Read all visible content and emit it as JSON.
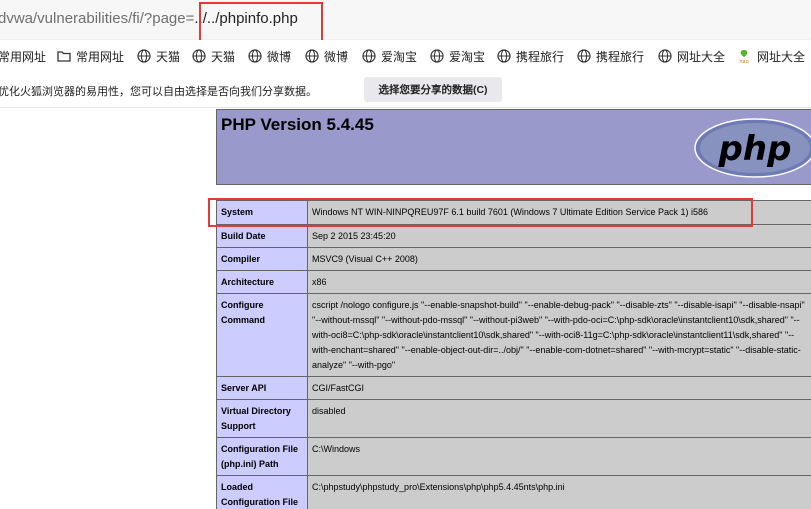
{
  "url": {
    "prefix": "dvwa/vulnerabilities/fi/?page=",
    "highlighted": "../../phpinfo.php"
  },
  "bookmarks": [
    {
      "label": "常用网址",
      "icon": "plain-bookmark"
    },
    {
      "label": "常用网址",
      "icon": "folder-icon"
    },
    {
      "label": "天猫",
      "icon": "globe-icon"
    },
    {
      "label": "天猫",
      "icon": "globe-icon"
    },
    {
      "label": "微博",
      "icon": "globe-icon"
    },
    {
      "label": "微博",
      "icon": "globe-icon"
    },
    {
      "label": "爱淘宝",
      "icon": "globe-icon"
    },
    {
      "label": "爱淘宝",
      "icon": "globe-icon"
    },
    {
      "label": "携程旅行",
      "icon": "globe-icon"
    },
    {
      "label": "携程旅行",
      "icon": "globe-icon"
    },
    {
      "label": "网址大全",
      "icon": "globe-icon"
    },
    {
      "label": "网址大全",
      "icon": "hao123-icon"
    }
  ],
  "notice": {
    "text": "优化火狐浏览器的易用性，您可以自由选择是否向我们分享数据。",
    "button": "选择您要分享的数据(C)"
  },
  "php": {
    "title": "PHP Version 5.4.45",
    "logo_text": "php",
    "rows": [
      {
        "key": "System",
        "value": "Windows NT WIN-NINPQREU97F 6.1 build 7601 (Windows 7 Ultimate Edition Service Pack 1) i586"
      },
      {
        "key": "Build Date",
        "value": "Sep 2 2015 23:45:20"
      },
      {
        "key": "Compiler",
        "value": "MSVC9 (Visual C++ 2008)"
      },
      {
        "key": "Architecture",
        "value": "x86"
      },
      {
        "key": "Configure Command",
        "value": "cscript /nologo configure.js \"--enable-snapshot-build\" \"--enable-debug-pack\" \"--disable-zts\" \"--disable-isapi\" \"--disable-nsapi\" \"--without-mssql\" \"--without-pdo-mssql\" \"--without-pi3web\" \"--with-pdo-oci=C:\\php-sdk\\oracle\\instantclient10\\sdk,shared\" \"--with-oci8=C:\\php-sdk\\oracle\\instantclient10\\sdk,shared\" \"--with-oci8-11g=C:\\php-sdk\\oracle\\instantclient11\\sdk,shared\" \"--with-enchant=shared\" \"--enable-object-out-dir=../obj/\" \"--enable-com-dotnet=shared\" \"--with-mcrypt=static\" \"--disable-static-analyze\" \"--with-pgo\""
      },
      {
        "key": "Server API",
        "value": "CGI/FastCGI"
      },
      {
        "key": "Virtual Directory Support",
        "value": "disabled"
      },
      {
        "key": "Configuration File (php.ini) Path",
        "value": "C:\\Windows"
      },
      {
        "key": "Loaded Configuration File",
        "value": "C:\\phpstudy\\phpstudy_pro\\Extensions\\php\\php5.4.45nts\\php.ini"
      }
    ]
  }
}
